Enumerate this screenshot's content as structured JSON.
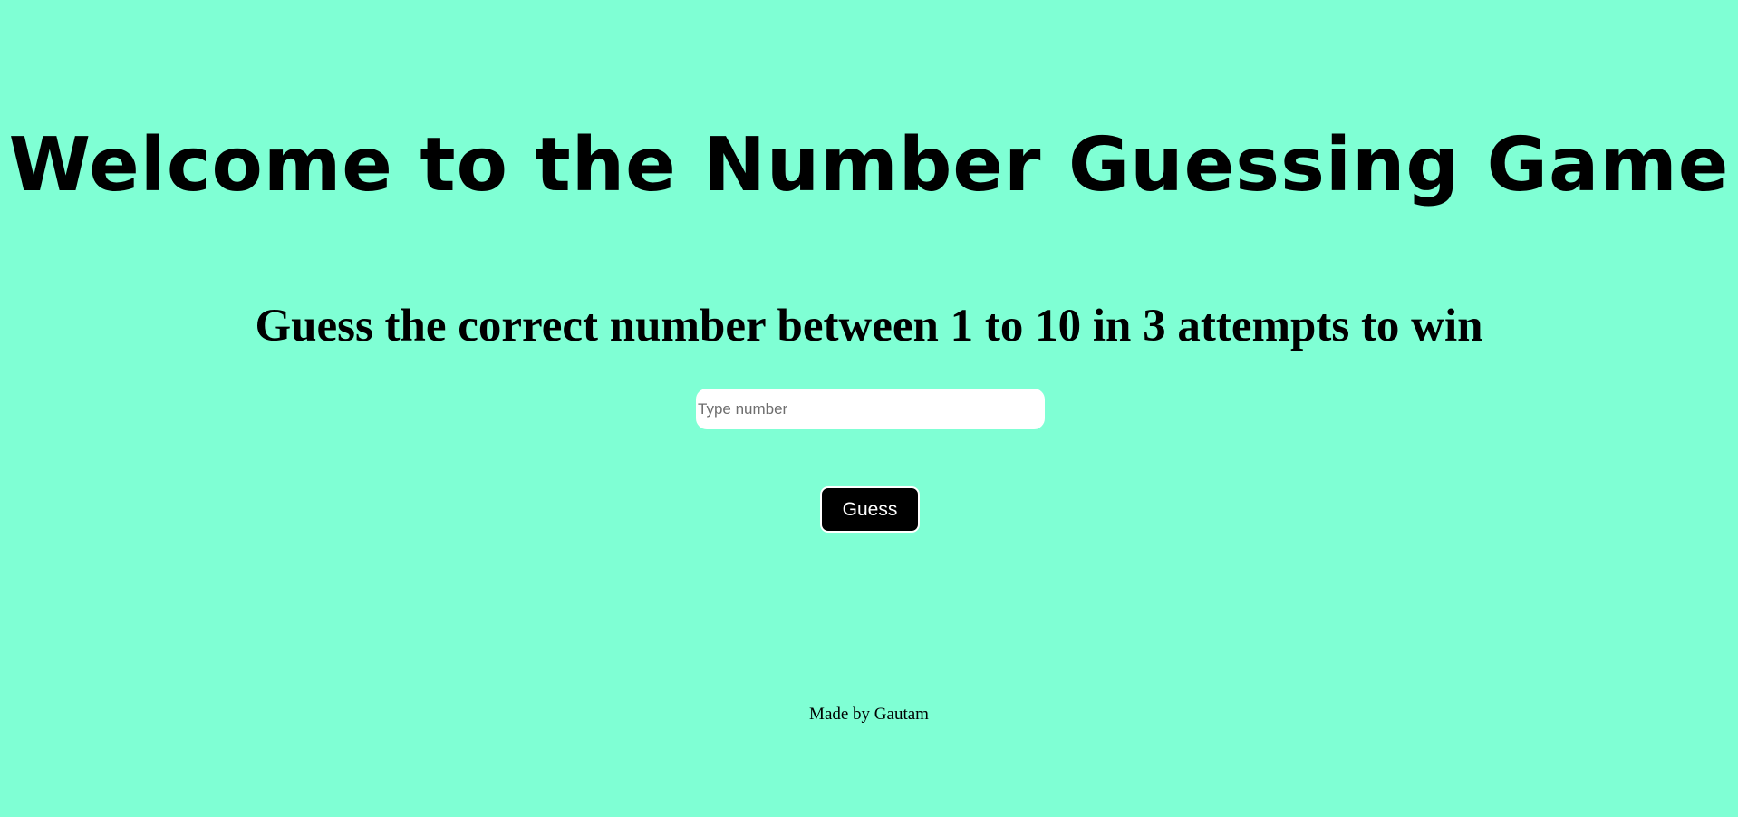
{
  "page": {
    "background_color": "#7fffd4"
  },
  "header": {
    "title": "Welcome to the Number Guessing Game"
  },
  "main": {
    "instructions": "Guess the correct number between 1 to 10 in 3 attempts to win",
    "guess_input": {
      "value": "",
      "placeholder": "Type number"
    },
    "guess_button_label": "Guess"
  },
  "footer": {
    "credit": "Made by Gautam"
  }
}
